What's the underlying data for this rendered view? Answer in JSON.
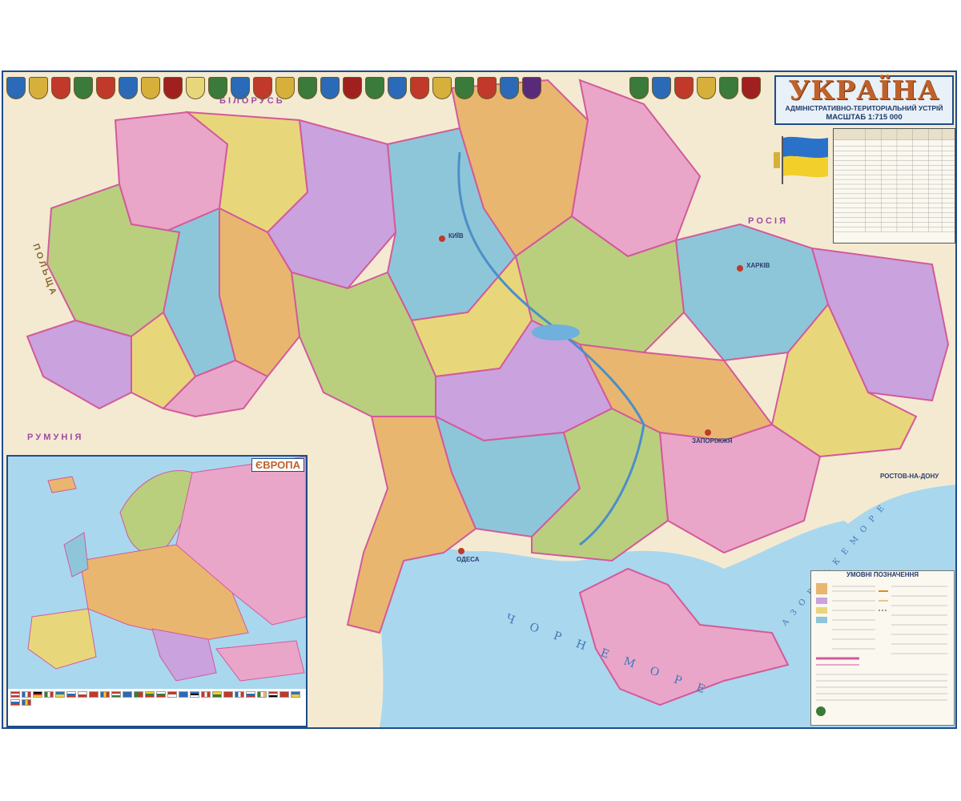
{
  "title": {
    "main": "УКРАЇНА",
    "subtitle": "АДМІНІСТРАТИВНО-ТЕРИТОРІАЛЬНИЙ УСТРІЙ",
    "scale": "МАСШТАБ 1:715 000"
  },
  "inset": {
    "title": "ЄВРОПА"
  },
  "labels": {
    "belarus": "Б І Л О Р У С Ь",
    "poland": "П О Л Ь Щ А",
    "russia": "Р О С І Я",
    "romania": "Р У М У Н І Я",
    "black_sea": "Ч О Р Н Е   М О Р Е",
    "azov_sea": "А З О В С Ь К Е   М О Р Е",
    "odesa": "ОДЕСА",
    "kyiv": "КИЇВ",
    "kharkiv": "ХАРКІВ",
    "zaporizhzhia": "ЗАПОРІЖЖЯ",
    "rostov": "РОСТОВ-НА-ДОНУ"
  },
  "legend": {
    "title": "УМОВНІ ПОЗНАЧЕННЯ"
  },
  "colors": {
    "pink": "#e9a6c9",
    "violet": "#c9a2de",
    "green": "#b9cf7e",
    "cyan": "#8ec6d9",
    "orange": "#e9b670",
    "yellow": "#e8d77a",
    "sea": "#a9d7ee",
    "land_outside": "#f4ead2",
    "frame": "#1f4b8a"
  }
}
